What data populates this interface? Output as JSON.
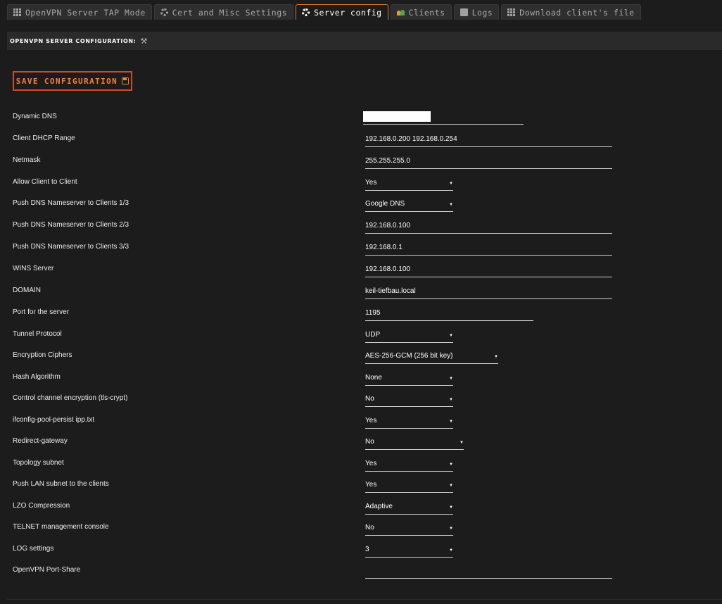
{
  "tabs": [
    {
      "label": "OpenVPN Server TAP Mode",
      "icon": "grid-icon"
    },
    {
      "label": "Cert and Misc Settings",
      "icon": "gear-icon"
    },
    {
      "label": "Server config",
      "icon": "gear-icon",
      "active": true
    },
    {
      "label": "Clients",
      "icon": "users-icon"
    },
    {
      "label": "Logs",
      "icon": "document-icon"
    },
    {
      "label": "Download client's file",
      "icon": "grid-icon"
    }
  ],
  "section": {
    "title": "OPENVPN SERVER CONFIGURATION:",
    "icon": "tools-icon"
  },
  "save_button": {
    "label": "SAVE CONFIGURATION",
    "icon": "floppy-disk-icon"
  },
  "colors": {
    "accent": "#e07a2a",
    "button_border": "#d8452e",
    "background": "#1c1c1c"
  },
  "fields": [
    {
      "label": "Dynamic DNS",
      "value": ""
    },
    {
      "label": "Client DHCP Range",
      "value": "192.168.0.200 192.168.0.254"
    },
    {
      "label": "Netmask",
      "value": "255.255.255.0"
    },
    {
      "label": "Allow Client to Client",
      "value": "Yes"
    },
    {
      "label": "Push DNS Nameserver to Clients 1/3",
      "value": "Google DNS"
    },
    {
      "label": "Push DNS Nameserver to Clients 2/3",
      "value": "192.168.0.100"
    },
    {
      "label": "Push DNS Nameserver to Clients 3/3",
      "value": "192.168.0.1"
    },
    {
      "label": "WINS Server",
      "value": "192.168.0.100"
    },
    {
      "label": "DOMAIN",
      "value": "keil-tiefbau.local"
    },
    {
      "label": "Port for the server",
      "value": "1195"
    },
    {
      "label": "Tunnel Protocol",
      "value": "UDP"
    },
    {
      "label": "Encryption Ciphers",
      "value": "AES-256-GCM (256 bit key)"
    },
    {
      "label": "Hash Algorithm",
      "value": "None"
    },
    {
      "label": "Control channel encryption (tls-crypt)",
      "value": "No"
    },
    {
      "label": "ifconfig-pool-persist ipp.txt",
      "value": "Yes"
    },
    {
      "label": "Redirect-gateway",
      "value": "No"
    },
    {
      "label": "Topology subnet",
      "value": "Yes"
    },
    {
      "label": "Push LAN subnet to the clients",
      "value": "Yes"
    },
    {
      "label": "LZO Compression",
      "value": "Adaptive"
    },
    {
      "label": "TELNET management console",
      "value": "No"
    },
    {
      "label": "LOG settings",
      "value": "3"
    },
    {
      "label": "OpenVPN Port-Share",
      "value": ""
    }
  ]
}
